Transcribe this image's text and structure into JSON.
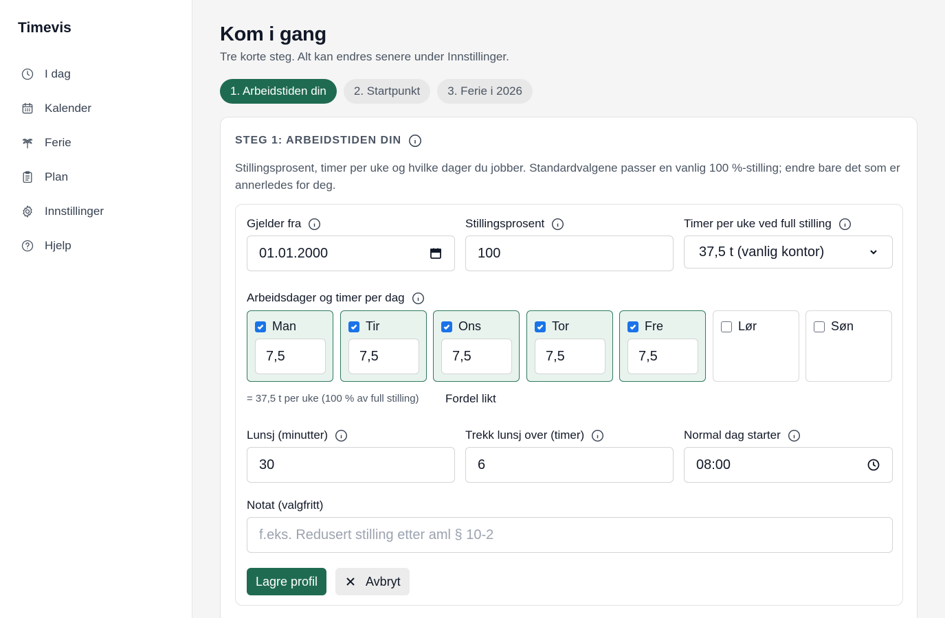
{
  "app": {
    "name": "Timevis"
  },
  "sidebar": {
    "items": [
      {
        "label": "I dag",
        "icon": "clock-icon"
      },
      {
        "label": "Kalender",
        "icon": "calendar-icon"
      },
      {
        "label": "Ferie",
        "icon": "palm-tree-icon"
      },
      {
        "label": "Plan",
        "icon": "clipboard-icon"
      },
      {
        "label": "Innstillinger",
        "icon": "gear-icon"
      },
      {
        "label": "Hjelp",
        "icon": "help-circle-icon"
      }
    ]
  },
  "page": {
    "title": "Kom i gang",
    "subtitle": "Tre korte steg. Alt kan endres senere under Innstillinger."
  },
  "steps": [
    {
      "label": "1. Arbeidstiden din",
      "active": true
    },
    {
      "label": "2. Startpunkt",
      "active": false
    },
    {
      "label": "3. Ferie i 2026",
      "active": false
    }
  ],
  "card": {
    "title": "STEG 1: ARBEIDSTIDEN DIN",
    "description": "Stillingsprosent, timer per uke og hvilke dager du jobber. Standardvalgene passer en vanlig 100 %-stilling; endre bare det som er annerledes for deg."
  },
  "form": {
    "valid_from": {
      "label": "Gjelder fra",
      "value": "01.01.2000"
    },
    "percent": {
      "label": "Stillingsprosent",
      "value": "100"
    },
    "weekly_hours": {
      "label": "Timer per uke ved full stilling",
      "selected": "37,5 t (vanlig kontor)"
    },
    "workdays_label": "Arbeidsdager og timer per dag",
    "days": [
      {
        "label": "Man",
        "checked": true,
        "hours": "7,5"
      },
      {
        "label": "Tir",
        "checked": true,
        "hours": "7,5"
      },
      {
        "label": "Ons",
        "checked": true,
        "hours": "7,5"
      },
      {
        "label": "Tor",
        "checked": true,
        "hours": "7,5"
      },
      {
        "label": "Fre",
        "checked": true,
        "hours": "7,5"
      },
      {
        "label": "Lør",
        "checked": false,
        "hours": ""
      },
      {
        "label": "Søn",
        "checked": false,
        "hours": ""
      }
    ],
    "summary": "= 37,5 t per uke (100 % av full stilling)",
    "distribute_label": "Fordel likt",
    "lunch": {
      "label": "Lunsj (minutter)",
      "value": "30"
    },
    "lunch_threshold": {
      "label": "Trekk lunsj over (timer)",
      "value": "6"
    },
    "day_start": {
      "label": "Normal dag starter",
      "value": "08:00"
    },
    "note": {
      "label": "Notat (valgfritt)",
      "placeholder": "f.eks. Redusert stilling etter aml § 10-2",
      "value": ""
    }
  },
  "actions": {
    "save_label": "Lagre profil",
    "cancel_label": "Avbryt"
  },
  "colors": {
    "accent": "#1f6b52",
    "day_active_bg": "#e8f3ee",
    "checkbox": "#1a73e8"
  }
}
